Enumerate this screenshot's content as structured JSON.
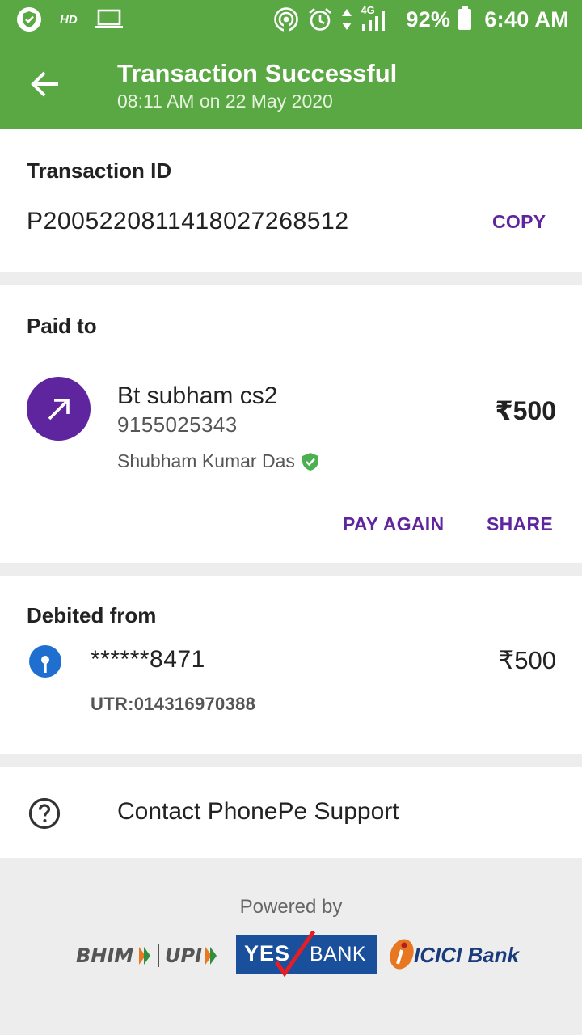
{
  "status_bar": {
    "hd_label": "HD",
    "network_label": "4G",
    "battery": "92%",
    "time": "6:40 AM"
  },
  "header": {
    "title": "Transaction Successful",
    "subtitle": "08:11 AM on 22 May 2020",
    "back_icon": "back-arrow-icon"
  },
  "transaction": {
    "label": "Transaction ID",
    "id": "P2005220811418027268512",
    "copy_label": "COPY"
  },
  "paid_to": {
    "label": "Paid to",
    "name": "Bt subham cs2",
    "phone": "9155025343",
    "verified_name": "Shubham Kumar Das",
    "amount": "₹500",
    "pay_again_label": "PAY AGAIN",
    "share_label": "SHARE"
  },
  "debited_from": {
    "label": "Debited from",
    "account": "******8471",
    "utr": "UTR:014316970388",
    "amount": "₹500"
  },
  "support": {
    "label": "Contact PhonePe Support"
  },
  "footer": {
    "powered_by": "Powered by",
    "logos": {
      "bhim": "BHIM",
      "upi": "UPI",
      "yes": "YES",
      "bank": "BANK",
      "icici": "ICICI Bank"
    }
  },
  "colors": {
    "header_green": "#5aa843",
    "accent_purple": "#5f259f",
    "verified_green": "#4caf50"
  }
}
